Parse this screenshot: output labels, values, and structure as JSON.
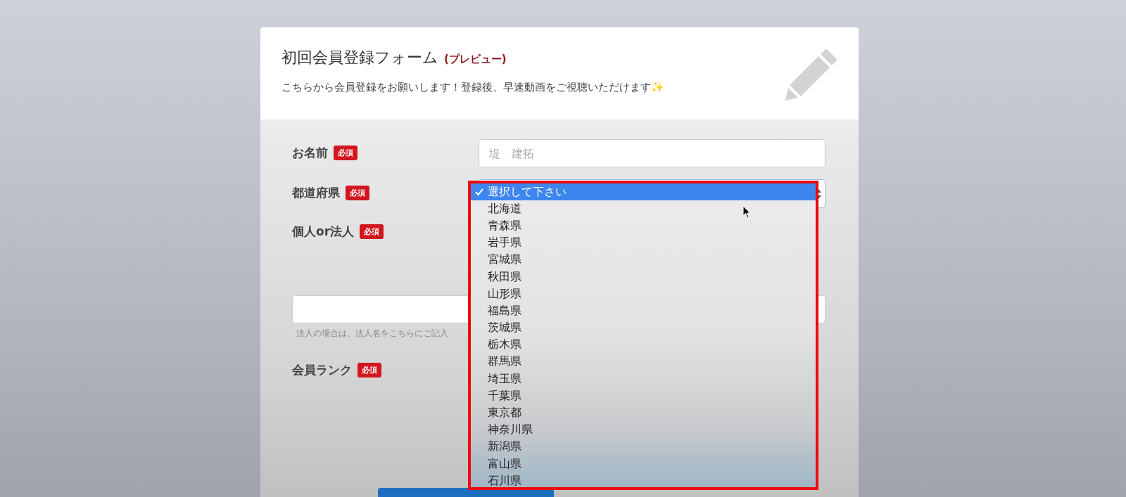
{
  "form": {
    "title": "初回会員登録フォーム",
    "title_tag": "(プレビュー)",
    "description": "こちらから会員登録をお願いします！登録後、早速動画をご視聴いただけます✨"
  },
  "fields": [
    {
      "kind": "text",
      "label": "お名前",
      "badge": "必須",
      "placeholder": "堤　建拓"
    },
    {
      "kind": "select",
      "label": "都道府県",
      "badge": "必須"
    },
    {
      "kind": "choice",
      "label": "個人or法人",
      "badge": "必須"
    },
    {
      "kind": "wide_text",
      "hint": "法人の場合は、法人名をこちらにご記入"
    },
    {
      "kind": "choice",
      "label": "会員ランク",
      "badge": "必須"
    }
  ],
  "dropdown": {
    "options": [
      {
        "label": "選択して下さい",
        "selected": true
      },
      {
        "label": "北海道",
        "selected": false
      },
      {
        "label": "青森県",
        "selected": false
      },
      {
        "label": "岩手県",
        "selected": false
      },
      {
        "label": "宮城県",
        "selected": false
      },
      {
        "label": "秋田県",
        "selected": false
      },
      {
        "label": "山形県",
        "selected": false
      },
      {
        "label": "福島県",
        "selected": false
      },
      {
        "label": "茨城県",
        "selected": false
      },
      {
        "label": "栃木県",
        "selected": false
      },
      {
        "label": "群馬県",
        "selected": false
      },
      {
        "label": "埼玉県",
        "selected": false
      },
      {
        "label": "千葉県",
        "selected": false
      },
      {
        "label": "東京都",
        "selected": false
      },
      {
        "label": "神奈川県",
        "selected": false
      },
      {
        "label": "新潟県",
        "selected": false
      },
      {
        "label": "富山県",
        "selected": false
      },
      {
        "label": "石川県",
        "selected": false
      }
    ]
  }
}
